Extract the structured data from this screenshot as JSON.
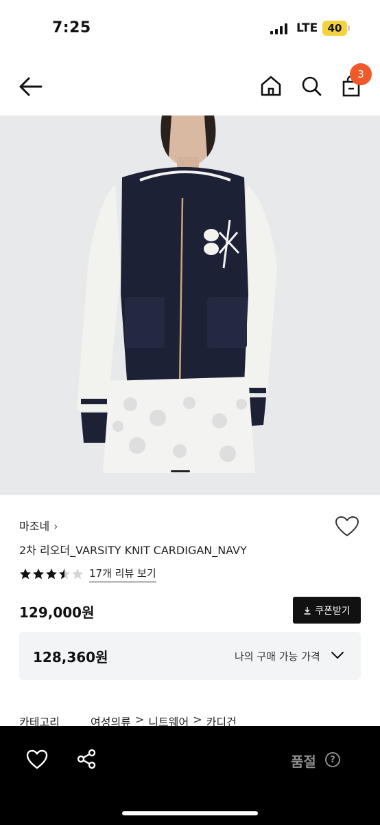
{
  "status": {
    "time": "7:25",
    "network": "LTE",
    "battery": "40"
  },
  "nav": {
    "cart_count": "3"
  },
  "product": {
    "brand": "마조네",
    "brand_chevron": "›",
    "title": "2차 리오더_VARSITY KNIT CARDIGAN_NAVY",
    "rating": 3.5,
    "rating_max": 5,
    "review_link": "17개 리뷰 보기",
    "price": "129,000원",
    "coupon_button": "쿠폰받기",
    "my_price": "128,360원",
    "my_price_label": "나의 구매 가능 가격",
    "image_index": 1
  },
  "category": {
    "label": "카테고리",
    "path": [
      "여성의류",
      "니트웨어",
      "카디건"
    ],
    "separator": ">"
  },
  "bottom": {
    "sold_out_label": "품절",
    "help_icon_text": "?"
  },
  "colors": {
    "badge": "#f1592a",
    "bottom_bar": "#000000",
    "coupon_bg": "#111111",
    "battery": "#f4d23c"
  }
}
